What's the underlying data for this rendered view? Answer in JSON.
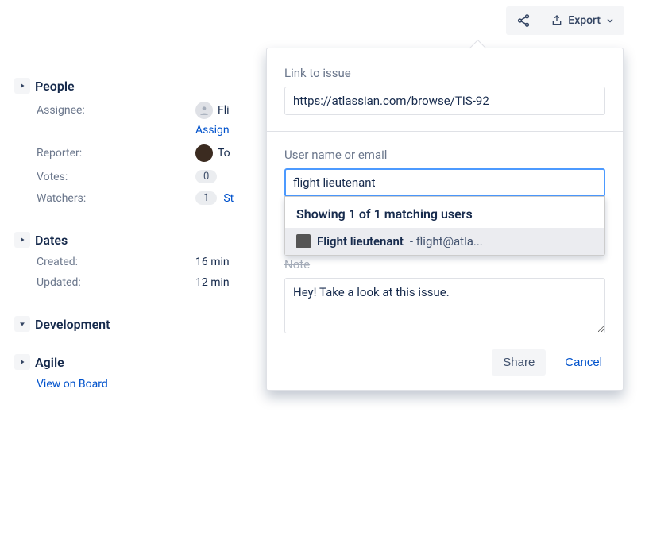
{
  "toolbar": {
    "export_label": "Export"
  },
  "sections": {
    "people": {
      "title": "People",
      "assignee_label": "Assignee:",
      "assignee_name": "Fli",
      "assign_link": "Assign",
      "reporter_label": "Reporter:",
      "reporter_name": "To",
      "votes_label": "Votes:",
      "votes_count": "0",
      "watchers_label": "Watchers:",
      "watchers_count": "1",
      "watchers_link": "St"
    },
    "dates": {
      "title": "Dates",
      "created_label": "Created:",
      "created_value": "16 min",
      "updated_label": "Updated:",
      "updated_value": "12 min"
    },
    "dev": {
      "title": "Development"
    },
    "agile": {
      "title": "Agile",
      "view_board": "View on Board"
    }
  },
  "popover": {
    "link_label": "Link to issue",
    "link_value": "https://atlassian.com/browse/TIS-92",
    "user_label": "User name or email",
    "user_value": "flight lieutenant",
    "suggest_header": "Showing 1 of 1 matching users",
    "suggest_name": "Flight lieutenant",
    "suggest_email": " - flight@atla...",
    "note_label": "Note",
    "note_value": "Hey! Take a look at this issue.",
    "share_label": "Share",
    "cancel_label": "Cancel"
  }
}
